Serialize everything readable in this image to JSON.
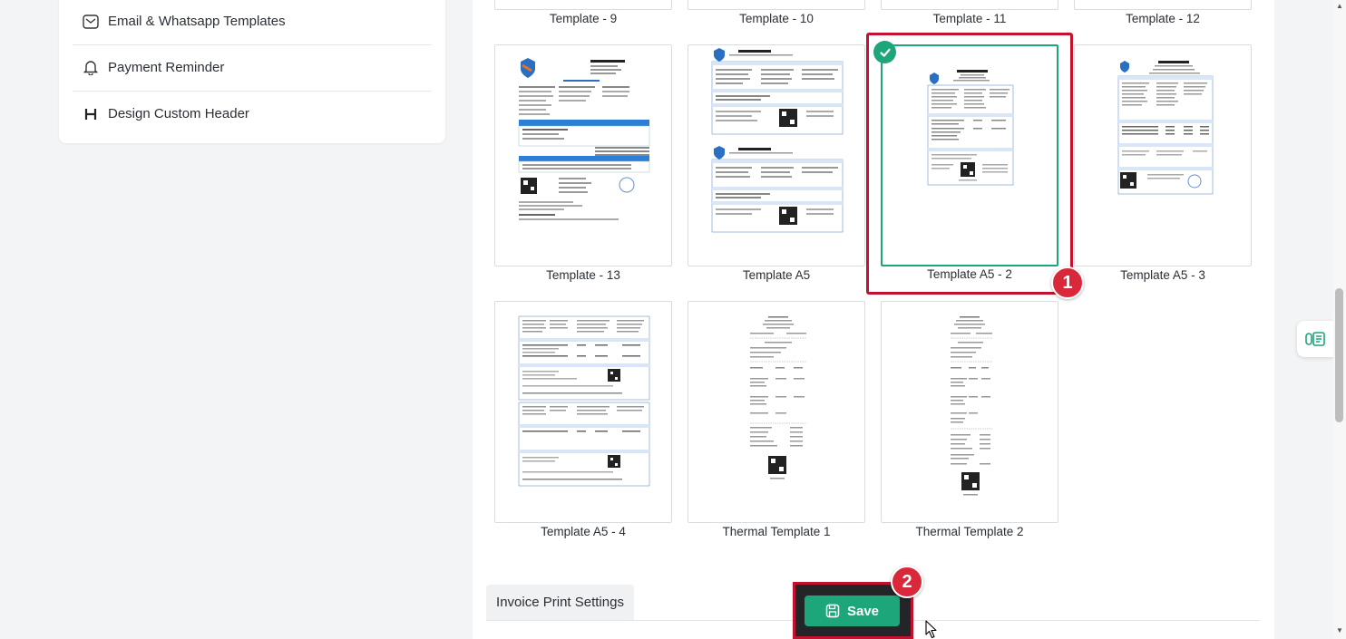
{
  "sidebar": {
    "items": [
      {
        "label": "Email & Whatsapp Templates",
        "icon": "envelope-icon"
      },
      {
        "label": "Payment Reminder",
        "icon": "bell-icon"
      },
      {
        "label": "Design Custom Header",
        "icon": "header-h-icon"
      }
    ]
  },
  "templates": {
    "top_row_labels": [
      "Template - 9",
      "Template - 10",
      "Template - 11",
      "Template - 12"
    ],
    "row2": [
      "Template - 13",
      "Template A5",
      "Template A5 - 2",
      "Template A5 - 3"
    ],
    "row3": [
      "Template A5 - 4",
      "Thermal Template 1",
      "Thermal Template 2"
    ],
    "selected": "Template A5 - 2"
  },
  "annotations": {
    "step1": "1",
    "step2": "2"
  },
  "settings_tab": {
    "label": "Invoice Print Settings"
  },
  "save_button": {
    "label": "Save"
  },
  "colors": {
    "accent": "#1ca67a",
    "highlight": "#c4122e",
    "badge": "#d8283a"
  }
}
